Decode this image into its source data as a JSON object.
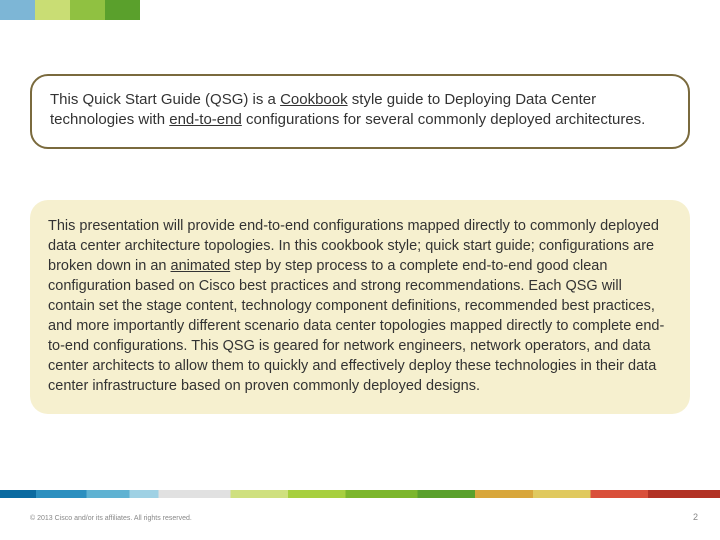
{
  "summary_box": {
    "text_parts": [
      "This Quick Start Guide (QSG) is a ",
      "Cookbook",
      " style guide to Deploying Data Center technologies with ",
      "end-to-end",
      " configurations for several commonly deployed architectures."
    ]
  },
  "detail_box": {
    "text_parts": [
      "This presentation will provide end-to-end configurations mapped directly to commonly deployed data center architecture topologies.  In this cookbook style; quick start guide; configurations are broken down in an ",
      "animated",
      " step by step process to a complete end-to-end good clean configuration based on Cisco best practices and strong recommendations. Each QSG will contain set the stage content, technology component definitions, recommended best practices, and more importantly different scenario data center topologies mapped directly to complete end-to-end configurations.  This QSG is geared for network engineers, network operators, and data center architects to allow them to quickly and effectively deploy these technologies in their data center infrastructure based on proven commonly deployed designs."
    ]
  },
  "footer": {
    "copyright": "© 2013 Cisco and/or its affiliates. All rights reserved.",
    "page_number": "2"
  }
}
